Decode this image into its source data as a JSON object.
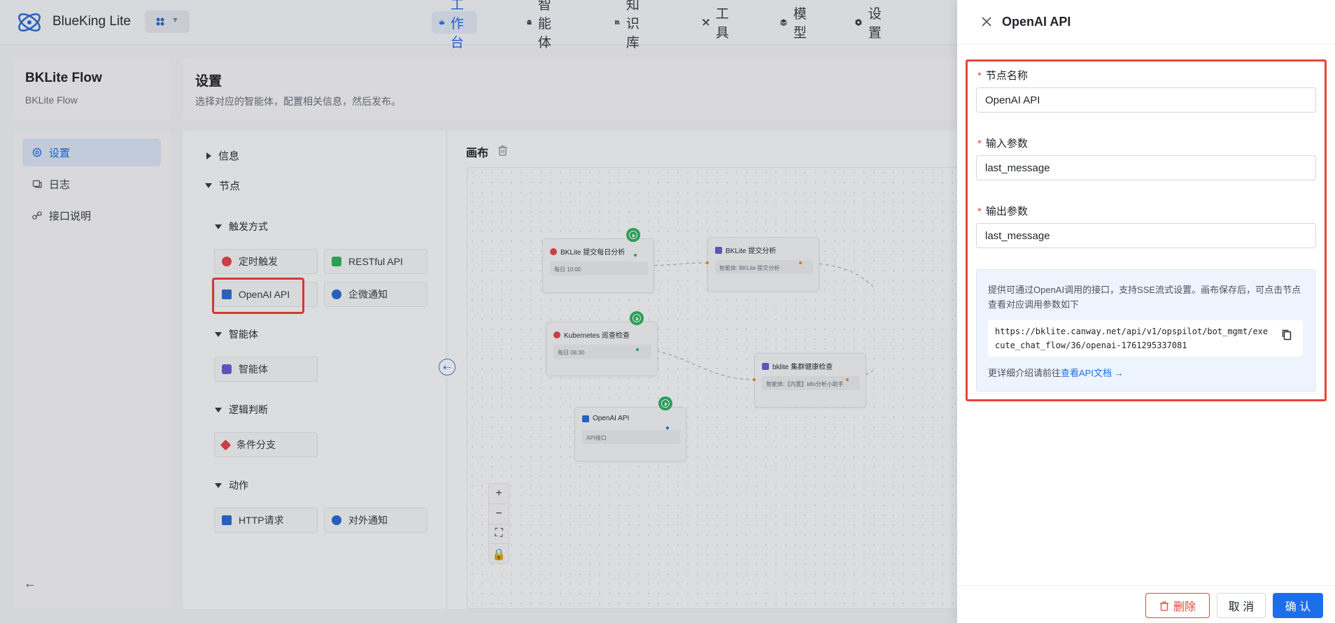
{
  "app": {
    "title": "BlueKing Lite"
  },
  "nav": [
    {
      "label": "工作台",
      "icon": "robot-icon",
      "active": true
    },
    {
      "label": "智能体",
      "icon": "ghost-icon",
      "active": false
    },
    {
      "label": "知识库",
      "icon": "library-icon",
      "active": false
    },
    {
      "label": "工具",
      "icon": "tools-icon",
      "active": false
    },
    {
      "label": "模型",
      "icon": "layers-icon",
      "active": false
    },
    {
      "label": "设置",
      "icon": "gear-icon",
      "active": false
    }
  ],
  "flow": {
    "title": "BKLite Flow",
    "subtitle": "BKLite Flow"
  },
  "sidebar": {
    "items": [
      {
        "label": "设置",
        "icon": "settings-icon",
        "active": true
      },
      {
        "label": "日志",
        "icon": "log-icon",
        "active": false
      },
      {
        "label": "接口说明",
        "icon": "link-icon",
        "active": false
      }
    ]
  },
  "header": {
    "title": "设置",
    "description": "选择对应的智能体，配置相关信息，然后发布。"
  },
  "palette": {
    "info_label": "信息",
    "nodes_label": "节点",
    "groups": {
      "trigger": "触发方式",
      "agent": "智能体",
      "logic": "逻辑判断",
      "action": "动作"
    },
    "items": {
      "timer": "定时触发",
      "restful": "RESTful API",
      "openai": "OpenAI API",
      "wecom": "企微通知",
      "agent": "智能体",
      "condition": "条件分支",
      "http": "HTTP请求",
      "notify": "对外通知"
    }
  },
  "canvas": {
    "title": "画布",
    "nodes": {
      "n1": {
        "title": "BKLite 提交每日分析",
        "body": "每日 10:00"
      },
      "n2": {
        "title": "BKLite 提交分析",
        "body": "智能体: BKLite 提交分析"
      },
      "n3": {
        "title": "Kubernetes 巡查检查",
        "body": "每日 08:30"
      },
      "n4": {
        "title": "bklite 集群健康检查",
        "body": "智能体:【内置】k8s分析小助手"
      },
      "n5": {
        "title": "OpenAI API",
        "body": "API接口"
      }
    }
  },
  "drawer": {
    "title": "OpenAI API",
    "fields": {
      "node_name": {
        "label": "节点名称",
        "value": "OpenAI API"
      },
      "input_params": {
        "label": "输入参数",
        "value": "last_message"
      },
      "output_params": {
        "label": "输出参数",
        "value": "last_message"
      }
    },
    "info": {
      "text": "提供可通过OpenAI调用的接口，支持SSE流式设置。画布保存后，可点击节点查看对应调用参数如下",
      "url": "https://bklite.canway.net/api/v1/opspilot/bot_mgmt/execute_chat_flow/36/openai-1761295337081",
      "more_prefix": "更详细介绍请前往",
      "more_link": "查看API文档 →"
    },
    "buttons": {
      "delete": "删除",
      "cancel": "取 消",
      "ok": "确 认"
    }
  },
  "colors": {
    "accent": "#1e6ee8",
    "danger": "#e8453c",
    "success": "#2fb566"
  }
}
